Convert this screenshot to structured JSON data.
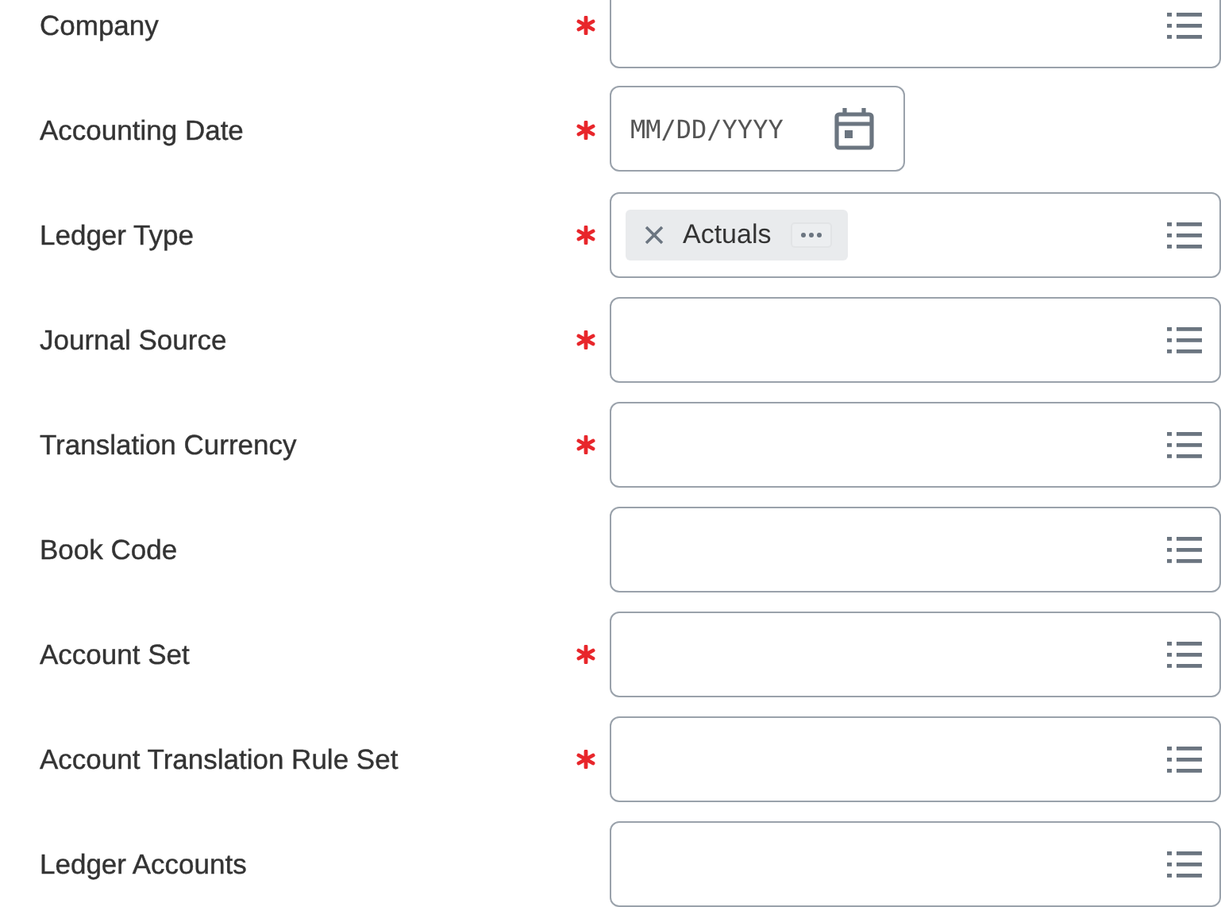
{
  "fields": [
    {
      "label": "Company",
      "required": true,
      "kind": "prompt"
    },
    {
      "label": "Accounting Date",
      "required": true,
      "kind": "date",
      "placeholder": "MM/DD/YYYY"
    },
    {
      "label": "Ledger Type",
      "required": true,
      "kind": "prompt",
      "tokens": [
        {
          "label": "Actuals"
        }
      ]
    },
    {
      "label": "Journal Source",
      "required": true,
      "kind": "prompt"
    },
    {
      "label": "Translation Currency",
      "required": true,
      "kind": "prompt"
    },
    {
      "label": "Book Code",
      "required": false,
      "kind": "prompt"
    },
    {
      "label": "Account Set",
      "required": true,
      "kind": "prompt"
    },
    {
      "label": "Account Translation Rule Set",
      "required": true,
      "kind": "prompt"
    },
    {
      "label": "Ledger Accounts",
      "required": false,
      "kind": "prompt"
    }
  ]
}
